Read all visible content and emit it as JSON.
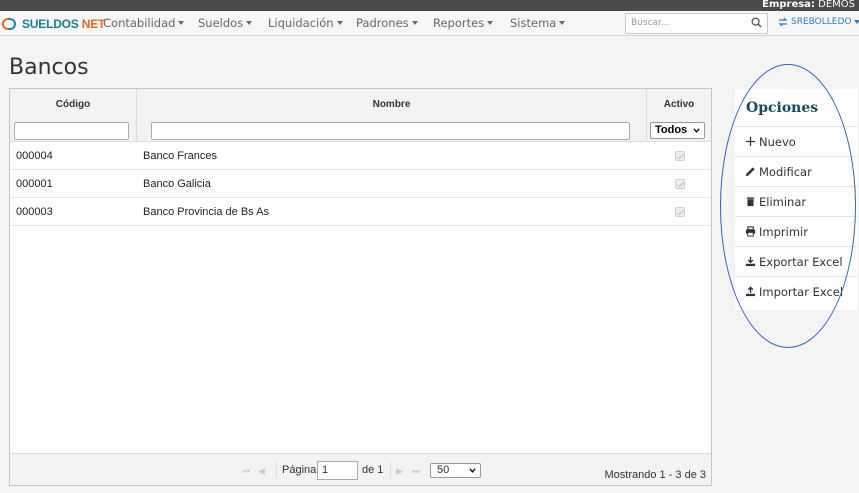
{
  "topbar": {
    "empresa_label": "Empresa:",
    "empresa_value": "DEMOS"
  },
  "brand": {
    "part1": "SUELDOS",
    "part2": "NET"
  },
  "nav": [
    {
      "label": "Contabilidad"
    },
    {
      "label": "Sueldos"
    },
    {
      "label": "Liquidación"
    },
    {
      "label": "Padrones"
    },
    {
      "label": "Reportes"
    },
    {
      "label": "Sistema"
    }
  ],
  "search": {
    "placeholder": "Buscar..."
  },
  "user": {
    "name": "SREBOLLEDO"
  },
  "page": {
    "title": "Bancos"
  },
  "grid": {
    "columns": [
      "Código",
      "Nombre",
      "Activo"
    ],
    "filter_activo": "Todos",
    "rows": [
      {
        "codigo": "000004",
        "nombre": "Banco Frances",
        "activo": true
      },
      {
        "codigo": "000001",
        "nombre": "Banco Galicia",
        "activo": true
      },
      {
        "codigo": "000003",
        "nombre": "Banco Provincia de Bs As",
        "activo": true
      }
    ],
    "pager": {
      "page_label": "Página",
      "page_value": "1",
      "of_label": "de 1",
      "page_size": "50",
      "summary": "Mostrando 1 - 3 de 3"
    }
  },
  "options": {
    "title": "Opciones",
    "items": [
      {
        "label": "Nuevo",
        "icon": "plus-icon"
      },
      {
        "label": "Modificar",
        "icon": "pencil-icon"
      },
      {
        "label": "Eliminar",
        "icon": "trash-icon"
      },
      {
        "label": "Imprimir",
        "icon": "print-icon"
      },
      {
        "label": "Exportar Excel",
        "icon": "download-icon"
      },
      {
        "label": "Importar Excel",
        "icon": "upload-icon"
      }
    ]
  },
  "colors": {
    "brand_teal": "#1d7d8c",
    "brand_orange": "#e8632b",
    "highlight_oval": "#3660b8",
    "options_title": "#1a4a5a"
  }
}
